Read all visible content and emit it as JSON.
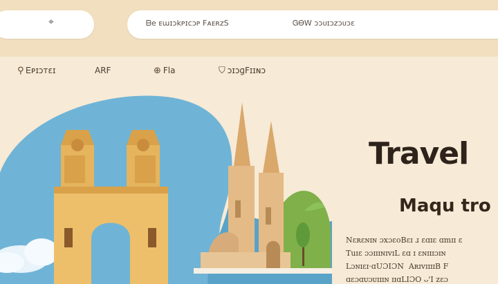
{
  "header": {
    "left_glyph": "⌖",
    "search_text_left": "ᗷe ᴇɯɪɔkᴘɪcɔᴘ FᴀᴇʀᴢS",
    "search_text_right": "ᏀᎾW ɔɔᴜɪɔᴢɔᴜɔɛ"
  },
  "nav": {
    "items": [
      {
        "icon": "pin-icon",
        "glyph": "⚲",
        "label": "Ꭼᴘɪɔᴛɛɪ"
      },
      {
        "icon": "",
        "glyph": "",
        "label": "ARF"
      },
      {
        "icon": "globe-icon",
        "glyph": "⊕",
        "label": "Fla"
      },
      {
        "icon": "shield-icon",
        "glyph": "⛉",
        "label": "ɔɪɔɡFɪɪɴɔ"
      }
    ]
  },
  "hero": {
    "title": "Travel",
    "subtitle": "Maqu tro",
    "description": [
      "Nɛʀɛɴɪɴ ɔxɔɛᴏBɛɪ ɹ ɛɑɪɛ ɑmɪɪ ɛ",
      "Tuɪɛ ɔɔɪɪɪɴɪᴠɪL ɛɑ ɪ ɛɴɪɪɪɔɪɴ",
      "Lɔɴɪɛɪ·ɑUƆIƆN  AʀɪᴠɪɪɪɪB F",
      "ɑɛɔɑᴜɔᴜɪɪɪɴ ɪɪɑLIƆO ᴗ'I ᴢɛɔ"
    ]
  },
  "colors": {
    "topbar": "#f1dfbf",
    "page": "#f7ead6",
    "water": "#6fb4d6",
    "stone": "#e6b45d"
  }
}
